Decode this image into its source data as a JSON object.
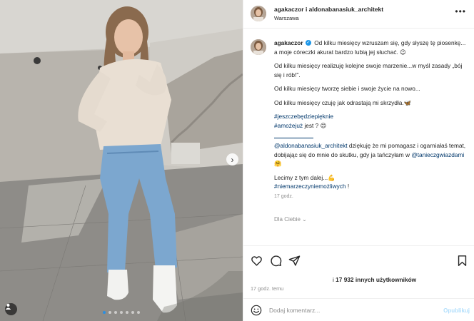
{
  "header": {
    "usernames": "agakaczor i aldonabanasiuk_architekt",
    "location": "Warszawa",
    "more_icon": "more-horizontal-icon"
  },
  "caption": {
    "username": "agakaczor",
    "verified_icon": "verified-badge-icon",
    "line1": "Od kilku miesięcy wzruszam się, gdy słyszę tę piosenkę... a moje córeczki akurat bardzo lubią jej słuchać. 😉",
    "line2": "Od kilku miesięcy realizuję kolejne swoje marzenie...w myśl zasady „bój się i rób!\".",
    "line3": "Od kilku miesięcy tworzę siebie i swoje życie na nowo...",
    "line4": "Od kilku miesięcy czuję jak odrastają mi skrzydła.🦋",
    "hashtag1": "#jeszczebędziepięknie",
    "hashtag2": "#amożejuż",
    "hashtag2_tail": "jest ? 😊",
    "mention1": "@aldonabanasiuk_architekt",
    "thanks_text": " dziękuję że mi pomagasz i ogarniałaś temat, dobijając się do mnie do skutku, gdy ja tańczyłam w ",
    "mention2": "@tanieczgwiazdami",
    "mention2_tail": " 🤗",
    "closing": "Lecimy z tym dalej...💪",
    "hashtag3": "#niemarzeczyniemożliwych",
    "hashtag3_tail": " !",
    "time": "17 godz.",
    "for_you": "Dla Ciebie ⌄"
  },
  "actions": {
    "like_icon": "heart-icon",
    "comment_icon": "comment-icon",
    "share_icon": "share-icon",
    "save_icon": "bookmark-icon",
    "likes_prefix": "i ",
    "likes_text": "17 932 innych użytkowników",
    "post_time": "17 godz. temu"
  },
  "comment_box": {
    "emoji_icon": "emoji-icon",
    "placeholder": "Dodaj komentarz...",
    "publish": "Opublikuj"
  },
  "photo": {
    "next_icon": "chevron-right-icon",
    "tag_icon": "user-tag-icon",
    "slide_count": 7,
    "active_slide": 1,
    "active_dot_color": "#2b8fe0"
  }
}
